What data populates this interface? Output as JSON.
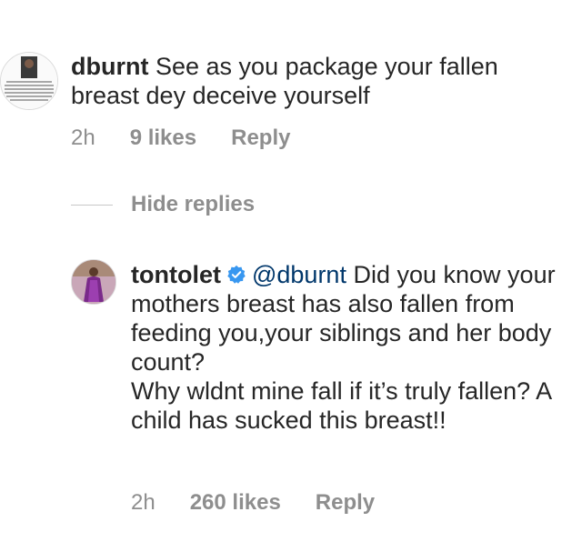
{
  "comment1": {
    "username": "dburnt",
    "text": "See as you package your fallen breast dey deceive yourself",
    "time": "2h",
    "likes": "9 likes",
    "reply": "Reply"
  },
  "replies_toggle": "Hide replies",
  "comment2": {
    "username": "tontolet",
    "mention": "@dburnt",
    "text_line1": "Did you know your mothers breast has also fallen from feeding you,your siblings and her body count?",
    "text_line2": "Why wldnt mine fall if it’s truly fallen? A child has sucked this breast!!",
    "time": "2h",
    "likes": "260 likes",
    "reply": "Reply"
  },
  "colors": {
    "text": "#262626",
    "muted": "#8e8e8e",
    "mention": "#00376b",
    "verified": "#3897f0"
  },
  "icons": {
    "verified_badge": "verified-badge-icon"
  }
}
